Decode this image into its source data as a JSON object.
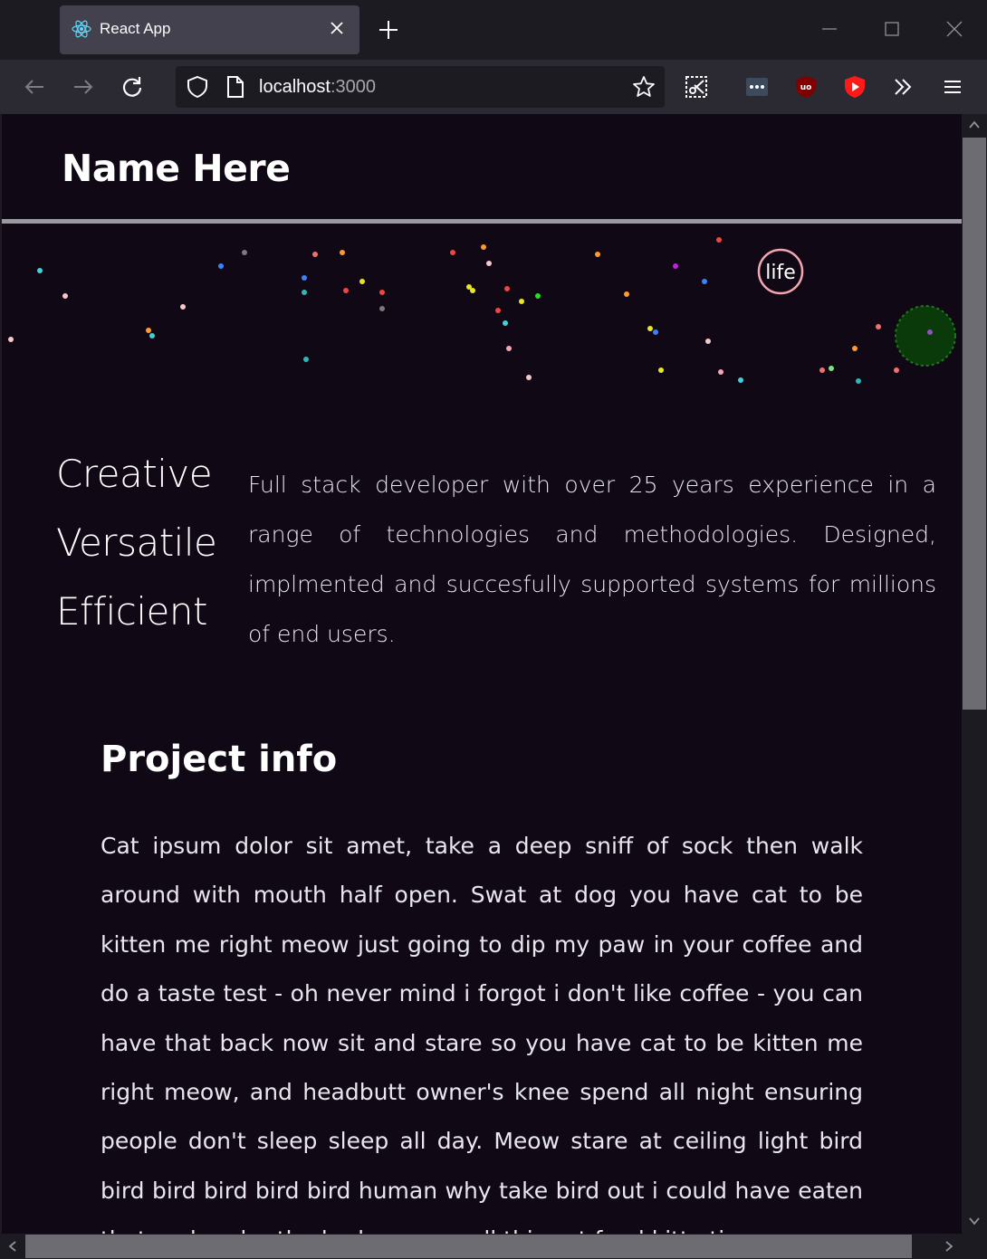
{
  "browser": {
    "tab_title": "React App",
    "url_host": "localhost",
    "url_port": ":3000",
    "icons": [
      "react-logo-icon",
      "close-icon",
      "plus-icon",
      "minimize-icon",
      "maximize-icon",
      "window-close-icon",
      "back-arrow-icon",
      "forward-arrow-icon",
      "reload-icon",
      "shield-icon",
      "page-icon",
      "star-icon",
      "screenshot-icon",
      "extension-dots-icon",
      "ublock-icon",
      "youtube-icon",
      "overflow-chevrons-icon",
      "hamburger-menu-icon"
    ]
  },
  "header": {
    "name": "Name Here"
  },
  "hero": {
    "particle_label": "life"
  },
  "traits": [
    "Creative",
    "Versatile",
    "Efficient"
  ],
  "summary": "Full stack developer with over 25 years experience in a range of technologies and methodologies. Designed, implmented and succesfully supported systems for millions of end users.",
  "project": {
    "title": "Project info",
    "body": "Cat ipsum dolor sit amet, take a deep sniff of sock then walk around with mouth half open. Swat at dog you have cat to be kitten me right meow just going to dip my paw in your coffee and do a taste test - oh never mind i forgot i don't like coffee - you can have that back now sit and stare so you have cat to be kitten me right meow, and headbutt owner's knee spend all night ensuring people don't sleep sleep all day. Meow stare at ceiling light bird bird bird bird bird bird human why take bird out i could have eaten that and under the bed, or you call this cat food kitty time"
  },
  "colors": {
    "page_bg": "#100814",
    "chrome_bg": "#1c1b22",
    "toolbar_bg": "#2b2a33",
    "tab_bg": "#42414d"
  }
}
